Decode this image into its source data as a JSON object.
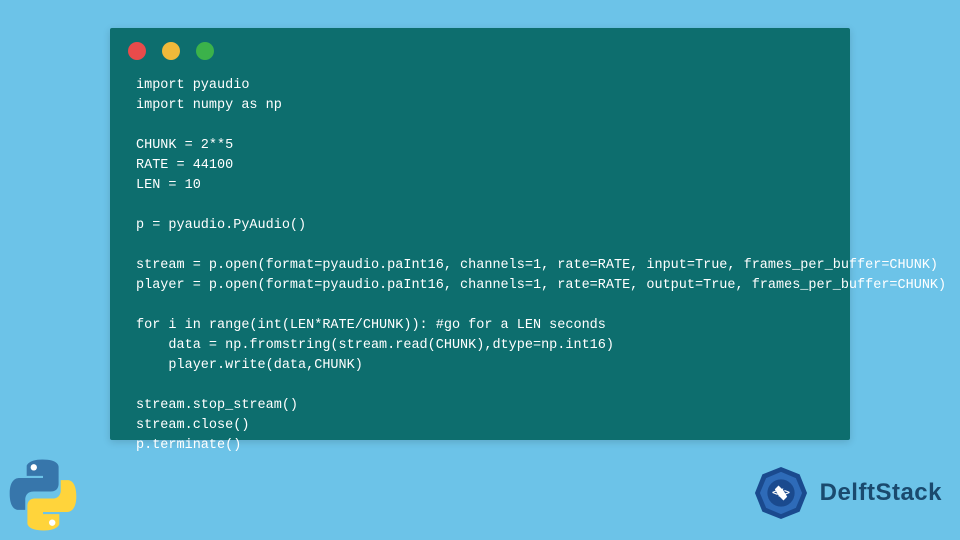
{
  "code": {
    "lines": [
      "import pyaudio",
      "import numpy as np",
      "",
      "CHUNK = 2**5",
      "RATE = 44100",
      "LEN = 10",
      "",
      "p = pyaudio.PyAudio()",
      "",
      "stream = p.open(format=pyaudio.paInt16, channels=1, rate=RATE, input=True, frames_per_buffer=CHUNK)",
      "player = p.open(format=pyaudio.paInt16, channels=1, rate=RATE, output=True, frames_per_buffer=CHUNK)",
      "",
      "for i in range(int(LEN*RATE/CHUNK)): #go for a LEN seconds",
      "    data = np.fromstring(stream.read(CHUNK),dtype=np.int16)",
      "    player.write(data,CHUNK)",
      "",
      "stream.stop_stream()",
      "stream.close()",
      "p.terminate()"
    ]
  },
  "brand": {
    "name": "DelftStack"
  }
}
